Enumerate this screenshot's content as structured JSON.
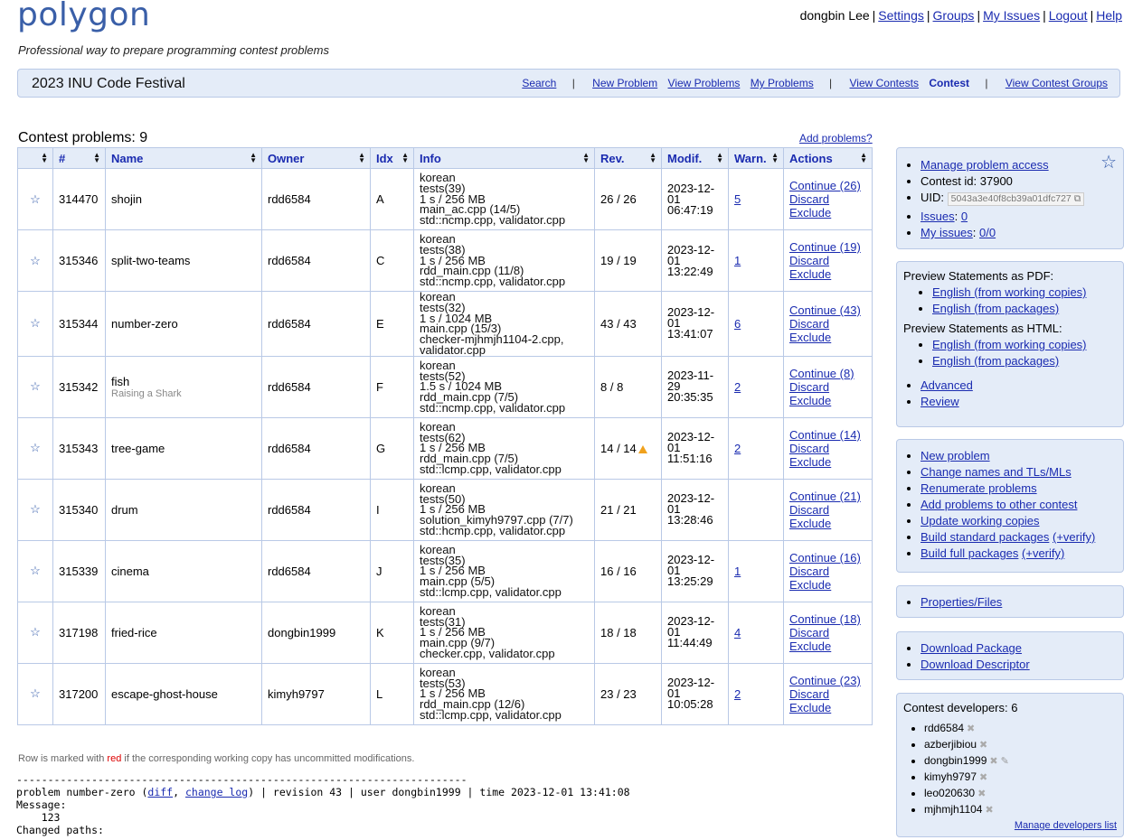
{
  "header": {
    "logo": "polygon",
    "tagline": "Professional way to prepare programming contest problems",
    "user": "dongbin Lee",
    "links": [
      "Settings",
      "Groups",
      "My Issues",
      "Logout",
      "Help"
    ]
  },
  "topbar": {
    "contest_name": "2023 INU Code Festival",
    "nav": {
      "search": "Search",
      "new_problem": "New Problem",
      "view_problems": "View Problems",
      "my_problems": "My Problems",
      "view_contests": "View Contests",
      "contest": "Contest",
      "view_contest_groups": "View Contest Groups",
      "sep": "|"
    }
  },
  "problems": {
    "title": "Contest problems: 9",
    "add_link": "Add problems?",
    "columns": [
      "#",
      "Name",
      "Owner",
      "Idx",
      "Info",
      "Rev.",
      "Modif.",
      "Warn.",
      "Actions"
    ],
    "rows": [
      {
        "id": "314470",
        "name": "shojin",
        "subtitle": "",
        "owner": "rdd6584",
        "idx": "A",
        "info": [
          "korean",
          "tests(39)",
          "1 s / 256 MB",
          "main_ac.cpp (14/5)",
          "std::ncmp.cpp, validator.cpp"
        ],
        "rev": "26 / 26",
        "warn_icon": false,
        "modif_date": "2023-12-01",
        "modif_time": "06:47:19",
        "warn": "5",
        "continue": "Continue (26)",
        "discard": "Discard",
        "exclude": "Exclude"
      },
      {
        "id": "315346",
        "name": "split-two-teams",
        "subtitle": "",
        "owner": "rdd6584",
        "idx": "C",
        "info": [
          "korean",
          "tests(38)",
          "1 s / 256 MB",
          "rdd_main.cpp (11/8)",
          "std::ncmp.cpp, validator.cpp"
        ],
        "rev": "19 / 19",
        "warn_icon": false,
        "modif_date": "2023-12-01",
        "modif_time": "13:22:49",
        "warn": "1",
        "continue": "Continue (19)",
        "discard": "Discard",
        "exclude": "Exclude"
      },
      {
        "id": "315344",
        "name": "number-zero",
        "subtitle": "",
        "owner": "rdd6584",
        "idx": "E",
        "info": [
          "korean",
          "tests(32)",
          "1 s / 1024 MB",
          "main.cpp (15/3)",
          "checker-mjhmjh1104-2.cpp,",
          "validator.cpp"
        ],
        "rev": "43 / 43",
        "warn_icon": false,
        "modif_date": "2023-12-01",
        "modif_time": "13:41:07",
        "warn": "6",
        "continue": "Continue (43)",
        "discard": "Discard",
        "exclude": "Exclude"
      },
      {
        "id": "315342",
        "name": "fish",
        "subtitle": "Raising a Shark",
        "owner": "rdd6584",
        "idx": "F",
        "info": [
          "korean",
          "tests(52)",
          "1.5 s / 1024 MB",
          "rdd_main.cpp (7/5)",
          "std::ncmp.cpp, validator.cpp"
        ],
        "rev": "8 / 8",
        "warn_icon": false,
        "modif_date": "2023-11-29",
        "modif_time": "20:35:35",
        "warn": "2",
        "continue": "Continue (8)",
        "discard": "Discard",
        "exclude": "Exclude"
      },
      {
        "id": "315343",
        "name": "tree-game",
        "subtitle": "",
        "owner": "rdd6584",
        "idx": "G",
        "info": [
          "korean",
          "tests(62)",
          "1 s / 256 MB",
          "rdd_main.cpp (7/5)",
          "std::lcmp.cpp, validator.cpp"
        ],
        "rev": "14 / 14",
        "warn_icon": true,
        "modif_date": "2023-12-01",
        "modif_time": "11:51:16",
        "warn": "2",
        "continue": "Continue (14)",
        "discard": "Discard",
        "exclude": "Exclude"
      },
      {
        "id": "315340",
        "name": "drum",
        "subtitle": "",
        "owner": "rdd6584",
        "idx": "I",
        "info": [
          "korean",
          "tests(50)",
          "1 s / 256 MB",
          "solution_kimyh9797.cpp (7/7)",
          "std::hcmp.cpp, validator.cpp"
        ],
        "rev": "21 / 21",
        "warn_icon": false,
        "modif_date": "2023-12-01",
        "modif_time": "13:28:46",
        "warn": "",
        "continue": "Continue (21)",
        "discard": "Discard",
        "exclude": "Exclude"
      },
      {
        "id": "315339",
        "name": "cinema",
        "subtitle": "",
        "owner": "rdd6584",
        "idx": "J",
        "info": [
          "korean",
          "tests(35)",
          "1 s / 256 MB",
          "main.cpp (5/5)",
          "std::lcmp.cpp, validator.cpp"
        ],
        "rev": "16 / 16",
        "warn_icon": false,
        "modif_date": "2023-12-01",
        "modif_time": "13:25:29",
        "warn": "1",
        "continue": "Continue (16)",
        "discard": "Discard",
        "exclude": "Exclude"
      },
      {
        "id": "317198",
        "name": "fried-rice",
        "subtitle": "",
        "owner": "dongbin1999",
        "idx": "K",
        "info": [
          "korean",
          "tests(31)",
          "1 s / 256 MB",
          "main.cpp (9/7)",
          "checker.cpp, validator.cpp"
        ],
        "rev": "18 / 18",
        "warn_icon": false,
        "modif_date": "2023-12-01",
        "modif_time": "11:44:49",
        "warn": "4",
        "continue": "Continue (18)",
        "discard": "Discard",
        "exclude": "Exclude"
      },
      {
        "id": "317200",
        "name": "escape-ghost-house",
        "subtitle": "",
        "owner": "kimyh9797",
        "idx": "L",
        "info": [
          "korean",
          "tests(53)",
          "1 s / 256 MB",
          "rdd_main.cpp (12/6)",
          "std::lcmp.cpp, validator.cpp"
        ],
        "rev": "23 / 23",
        "warn_icon": false,
        "modif_date": "2023-12-01",
        "modif_time": "10:05:28",
        "warn": "2",
        "continue": "Continue (23)",
        "discard": "Discard",
        "exclude": "Exclude"
      }
    ]
  },
  "note": {
    "before": "Row is marked with ",
    "red": "red",
    "after": " if the corresponding working copy has uncommitted modifications."
  },
  "log": {
    "divider": "------------------------------------------------------------------------",
    "prefix": "problem number-zero (",
    "diff": "diff",
    "comma": ", ",
    "changelog": "change log",
    "suffix": ") | revision 43 | user dongbin1999 | time 2023-12-01 13:41:08",
    "message_label": "Message:",
    "message": "    123",
    "changed_paths": "Changed paths:"
  },
  "sidebar": {
    "manage_access": "Manage problem access",
    "contest_id": "Contest id: 37900",
    "uid_label": "UID:",
    "uid": "5043a3e40f8cb39a01dfc727",
    "issues_label": "Issues",
    "issues_count": "0",
    "my_issues_label": "My issues",
    "my_issues_count": "0/0",
    "pdf_title": "Preview Statements as PDF:",
    "html_title": "Preview Statements as HTML:",
    "en_working": "English (from working copies)",
    "en_packages": "English (from packages)",
    "advanced": "Advanced",
    "review": "Review",
    "actions": [
      "New problem",
      "Change names and TLs/MLs",
      "Renumerate problems",
      "Add problems to other contest",
      "Update working copies"
    ],
    "build_standard": "Build standard packages",
    "build_full": "Build full packages",
    "verify": "(+verify)",
    "properties": "Properties/Files",
    "download_package": "Download Package",
    "download_descriptor": "Download Descriptor",
    "developers_title": "Contest developers: 6",
    "developers": [
      "rdd6584",
      "azberjibiou",
      "dongbin1999",
      "kimyh9797",
      "leo020630",
      "mjhmjh1104"
    ],
    "manage_devs": "Manage developers list"
  },
  "icons": {
    "star": "star-icon",
    "warning": "warning-icon",
    "copy": "copy-icon",
    "remove": "remove-icon",
    "edit": "pencil-icon"
  }
}
